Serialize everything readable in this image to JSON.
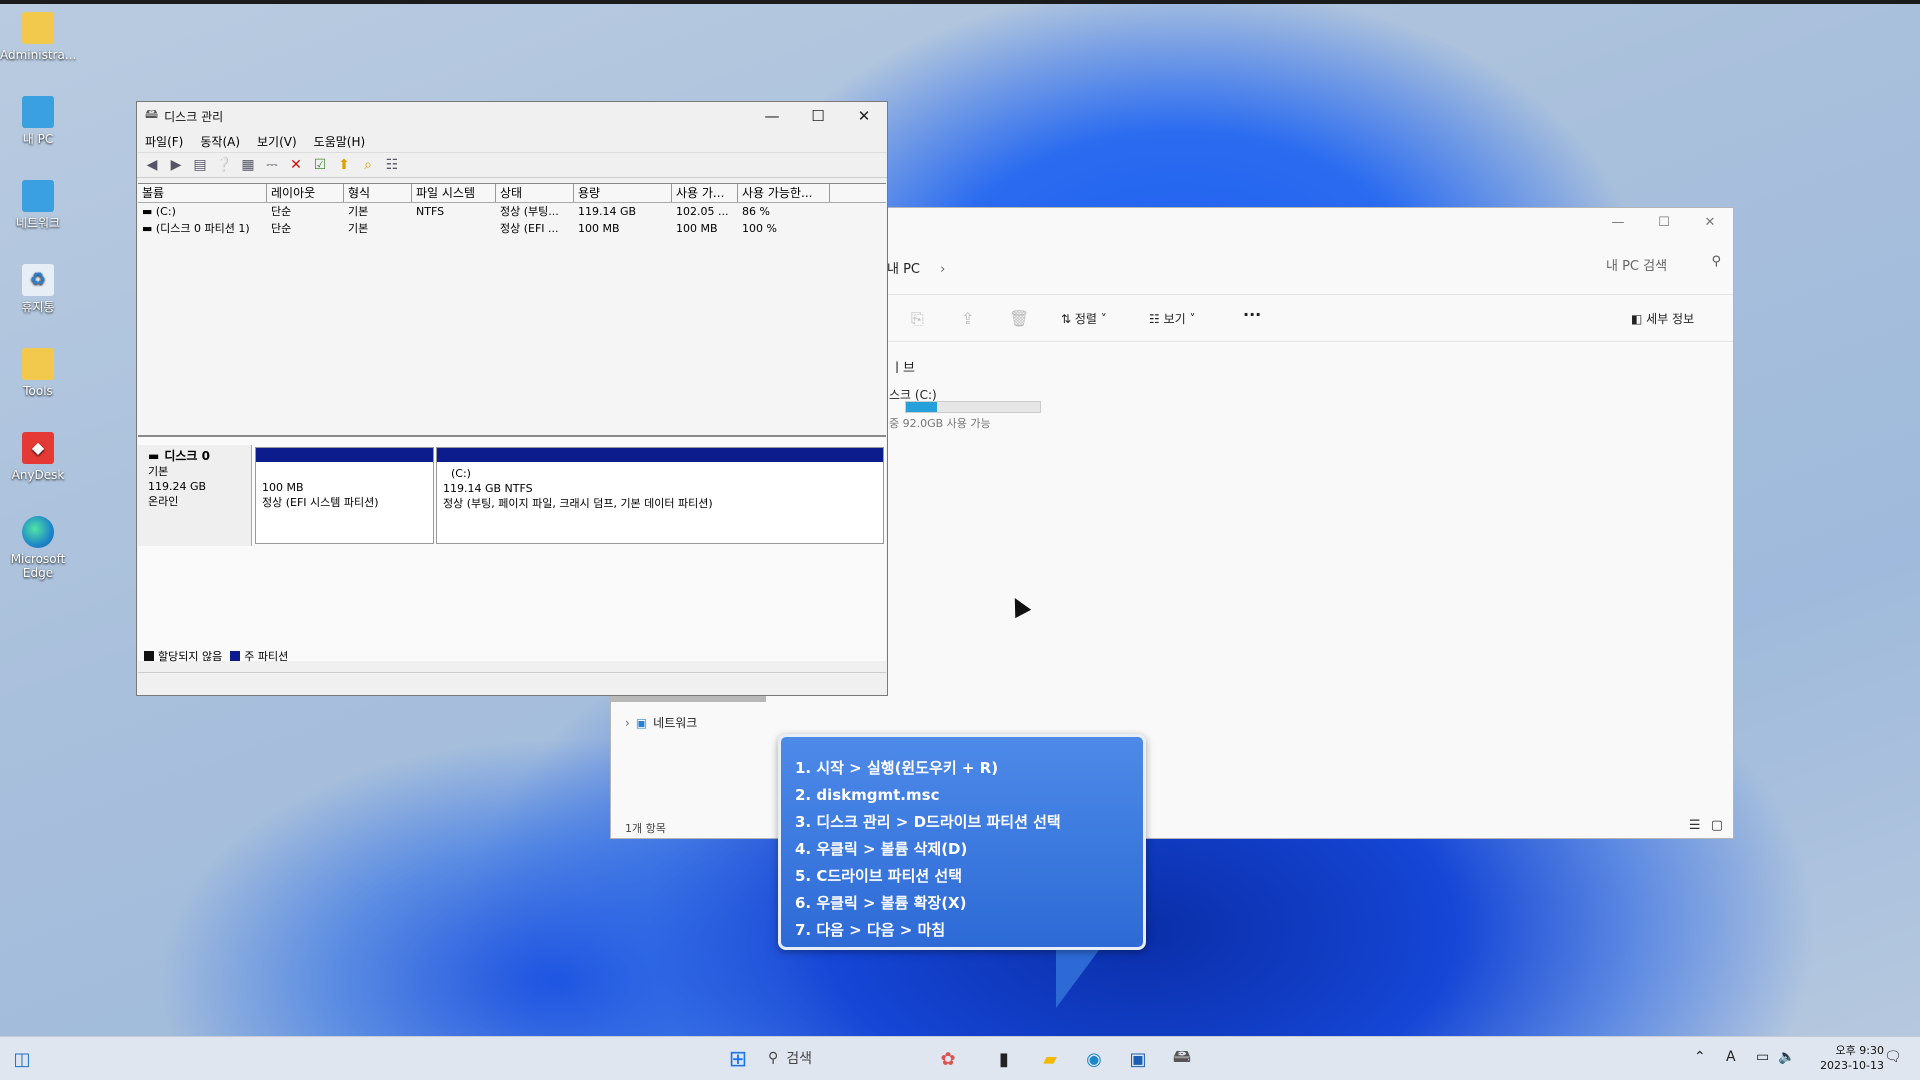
{
  "desktop": {
    "icons": [
      {
        "label": "Administra...",
        "icon": "folder-icon",
        "color": "#f2c94c"
      },
      {
        "label": "내 PC",
        "icon": "this-pc-icon",
        "color": "#3aa0e0"
      },
      {
        "label": "네트워크",
        "icon": "network-icon",
        "color": "#3aa0e0"
      },
      {
        "label": "휴지통",
        "icon": "recycle-bin-icon",
        "color": "#e8eef5"
      },
      {
        "label": "Tools",
        "icon": "folder-icon",
        "color": "#f2c94c"
      },
      {
        "label": "AnyDesk",
        "icon": "anydesk-icon",
        "color": "#e53935"
      },
      {
        "label": "Microsoft Edge",
        "icon": "edge-icon",
        "color": "#1e88c8"
      }
    ]
  },
  "explorer": {
    "breadcrumb": "내 PC",
    "breadcrumb_sep": "›",
    "search_placeholder": "내 PC 검색",
    "sort_label": "정렬",
    "view_label": "보기",
    "more_label": "···",
    "details_label": "세부 정보",
    "group_label": "ㅣ브",
    "drive_label": "스크 (C:)",
    "drive_free": "중 92.0GB 사용 가능",
    "drive_used_fraction": 0.23,
    "nav_network": "네트워크",
    "status": "1개 항목",
    "window_controls": {
      "minimize": "—",
      "maximize": "☐",
      "close": "✕"
    }
  },
  "diskmgmt": {
    "title": "디스크 관리",
    "window_controls": {
      "minimize": "—",
      "maximize": "☐",
      "close": "✕"
    },
    "menu": [
      "파일(F)",
      "동작(A)",
      "보기(V)",
      "도움말(H)"
    ],
    "columns": [
      "볼륨",
      "레이아웃",
      "형식",
      "파일 시스템",
      "상태",
      "용량",
      "사용 가...",
      "사용 가능한..."
    ],
    "rows": [
      [
        "(C:)",
        "단순",
        "기본",
        "NTFS",
        "정상 (부팅...",
        "119.14 GB",
        "102.05 ...",
        "86 %"
      ],
      [
        "(디스크 0 파티션 1)",
        "단순",
        "기본",
        "",
        "정상 (EFI ...",
        "100 MB",
        "100 MB",
        "100 %"
      ]
    ],
    "disk": {
      "name": "디스크 0",
      "type": "기본",
      "size": "119.24 GB",
      "status": "온라인"
    },
    "partitions": [
      {
        "name": "",
        "size": "100 MB",
        "status": "정상 (EFI 시스템 파티션)"
      },
      {
        "name": "(C:)",
        "size": "119.14 GB NTFS",
        "status": "정상 (부팅, 페이지 파일, 크래시 덤프, 기본 데이터 파티션)"
      }
    ],
    "legend": [
      {
        "label": "할당되지 않음",
        "color": "#111111"
      },
      {
        "label": "주 파티션",
        "color": "#0c1c8c"
      }
    ]
  },
  "callout": {
    "steps": [
      "1. 시작 > 실행(윈도우키 + R)",
      "2. diskmgmt.msc",
      "3. 디스크 관리 > D드라이브 파티션 선택",
      "4. 우클릭 > 볼륨 삭제(D)",
      "5. C드라이브 파티션 선택",
      "6. 우클릭 > 볼륨 확장(X)",
      "7. 다음 > 다음 > 마침"
    ]
  },
  "taskbar": {
    "search_label": "검색",
    "time": "오후 9:30",
    "date": "2023-10-13",
    "ime": "A"
  },
  "colors": {
    "primary_partition": "#0c1c8c",
    "callout_bg": "#2d6ad6"
  }
}
